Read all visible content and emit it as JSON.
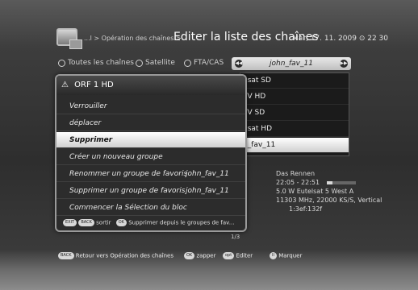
{
  "header": {
    "breadcrumb": "...l > Opération des chaînes >",
    "title": "Editer la liste des chaînes",
    "datetime": "Mar, 17. 11. 2009  ⊙ 22 30"
  },
  "filters": {
    "all": "Toutes les chaînes",
    "satellite": "Satellite",
    "fta": "FTA/CAS"
  },
  "group_selector": {
    "value": "john_fav_11",
    "prev_icon": "rewind-icon",
    "next_icon": "fast-forward-icon"
  },
  "fav_list": [
    "nsat SD",
    "TV HD",
    "TV SD",
    "nsat HD",
    "n_fav_11"
  ],
  "channel_info": {
    "name": "Das Rennen",
    "time": "22:05 - 22:51",
    "transponder": "5.0 W Eutelsat 5 West A",
    "frequency": "11303 MHz, 22000 KS/S, Vertical",
    "id": "1:3ef:132f",
    "progress": 0.2
  },
  "page_number": "1/3",
  "popup": {
    "title": "ORF 1 HD",
    "items": [
      {
        "label": "Verrouiller",
        "value": ""
      },
      {
        "label": "déplacer",
        "value": ""
      },
      {
        "label": "Supprimer",
        "value": ""
      },
      {
        "label": "Créer un nouveau groupe",
        "value": ""
      },
      {
        "label": "Renommer un groupe de favoris",
        "value": "john_fav_11"
      },
      {
        "label": "Supprimer un groupe de favoris",
        "value": "john_fav_11"
      },
      {
        "label": "Commencer la Sélection du bloc",
        "value": ""
      }
    ],
    "footer": {
      "exit_key": "EXIT",
      "back_key": "BACK",
      "back_label": "sortir",
      "ok_key": "OK",
      "ok_label": "Supprimer depuis le groupes de fav..."
    }
  },
  "bottom_bar": {
    "back_key": "BACK",
    "back_label": "Retour vers Opération des chaînes",
    "ok_key": "OK",
    "ok_label": "zapper",
    "opt_key": "opt",
    "opt_label": "Editer",
    "mark_key": "II",
    "mark_label": "Marquer"
  },
  "colors": {
    "selection": "#ffffff",
    "panel": "#2c2c2c"
  }
}
